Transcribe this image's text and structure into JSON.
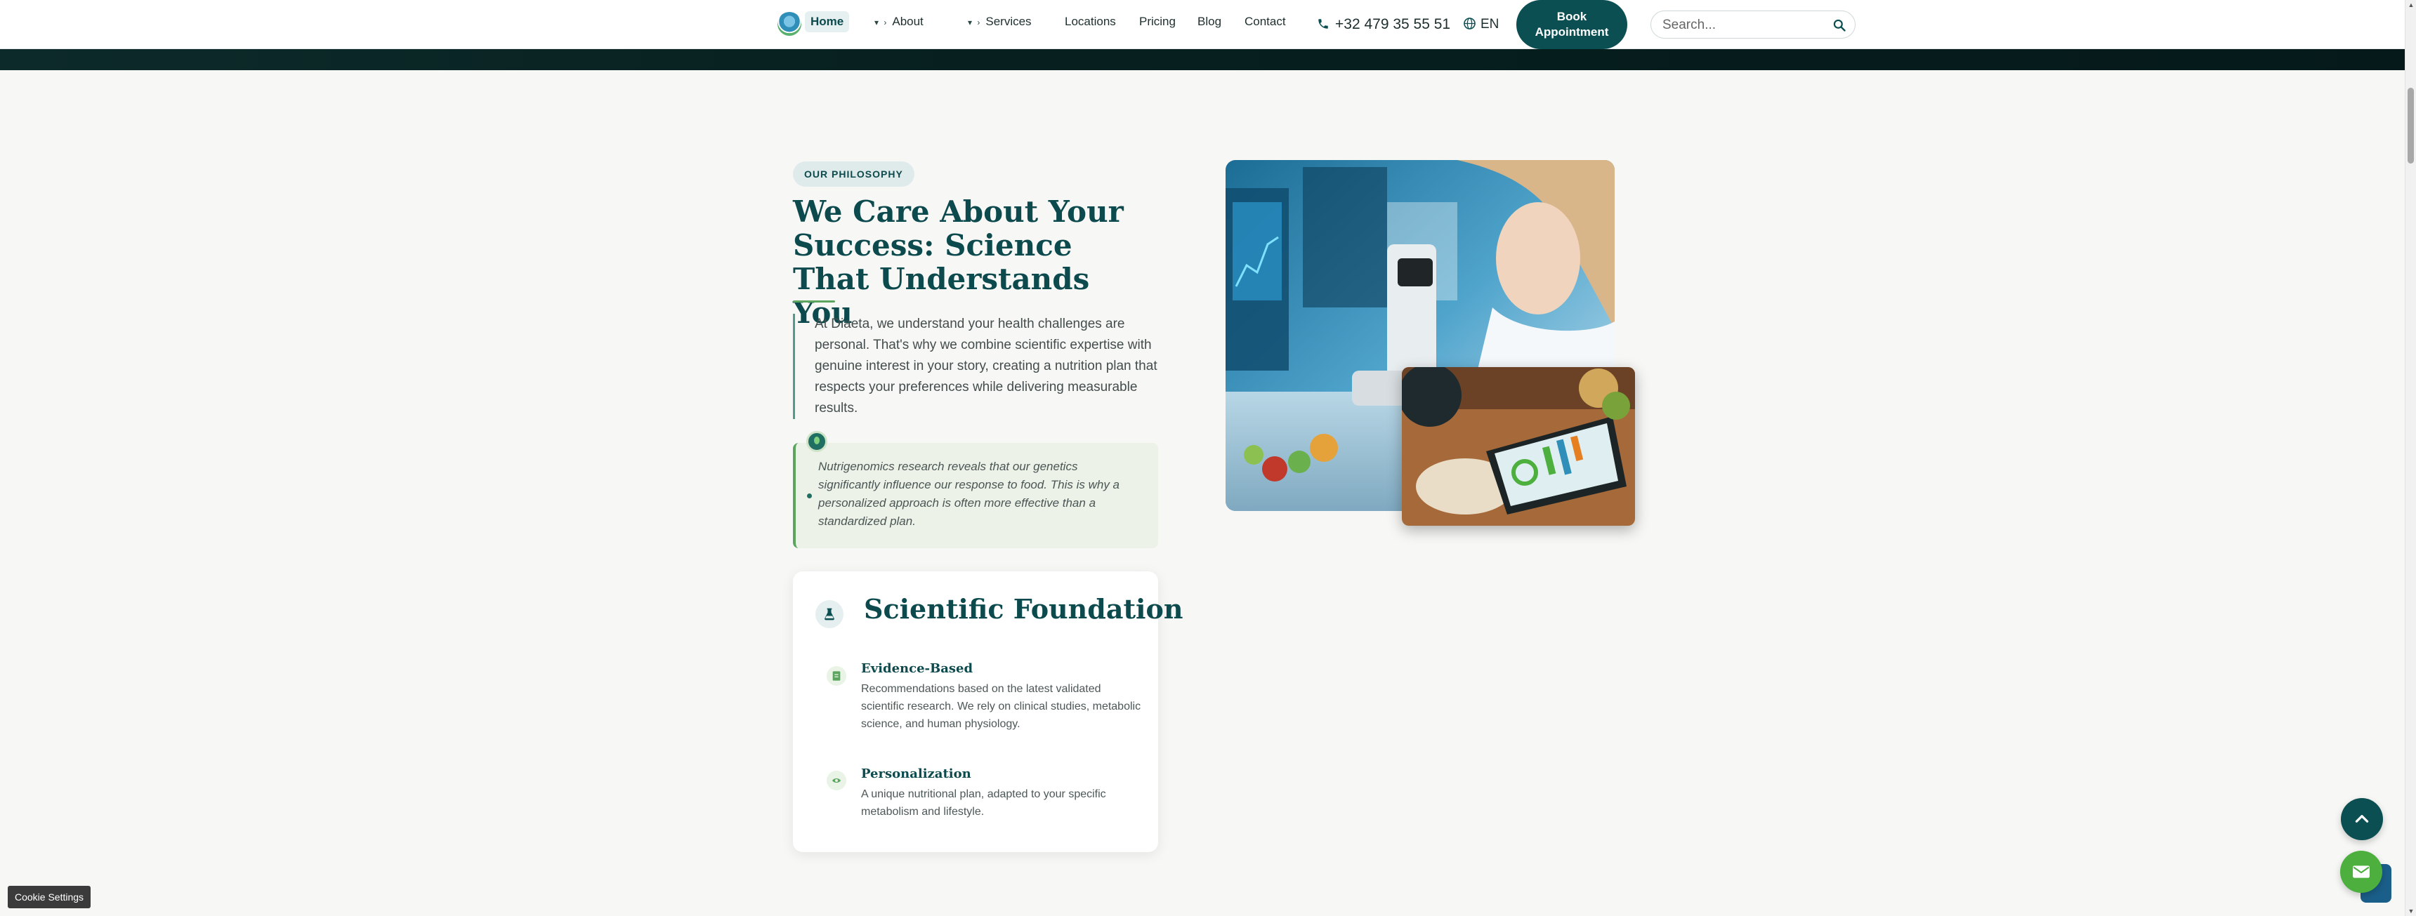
{
  "header": {
    "nav": {
      "home": "Home",
      "about": "About",
      "services": "Services",
      "locations": "Locations",
      "pricing": "Pricing",
      "blog": "Blog",
      "contact": "Contact"
    },
    "dropdown_caret": "▾ ›",
    "phone": "+32 479 35 55 51",
    "language": "EN",
    "book_button": "Book Appointment",
    "search_placeholder": "Search..."
  },
  "philosophy": {
    "badge": "OUR PHILOSOPHY",
    "title": "We Care About Your Success: Science That Understands You",
    "intro": "At Diaeta, we understand your health challenges are personal. That's why we combine scientific expertise with genuine interest in your story, creating a nutrition plan that respects your preferences while delivering measurable results.",
    "quote": "Nutrigenomics research reveals that our genetics significantly influence our response to food. This is why a personalized approach is often more effective than a standardized plan."
  },
  "card": {
    "title": "Scientific Foundation",
    "features": [
      {
        "title": "Evidence-Based",
        "text": "Recommendations based on the latest validated scientific research. We rely on clinical studies, metabolic science, and human physiology.",
        "icon": "document-icon"
      },
      {
        "title": "Personalization",
        "text": "A unique nutritional plan, adapted to your specific metabolism and lifestyle.",
        "icon": "dna-icon"
      }
    ]
  },
  "floating": {
    "cookie_settings": "Cookie Settings"
  },
  "colors": {
    "brand_teal": "#0b4f52",
    "accent_green": "#5ba55e",
    "mail_green": "#4caf3e"
  }
}
